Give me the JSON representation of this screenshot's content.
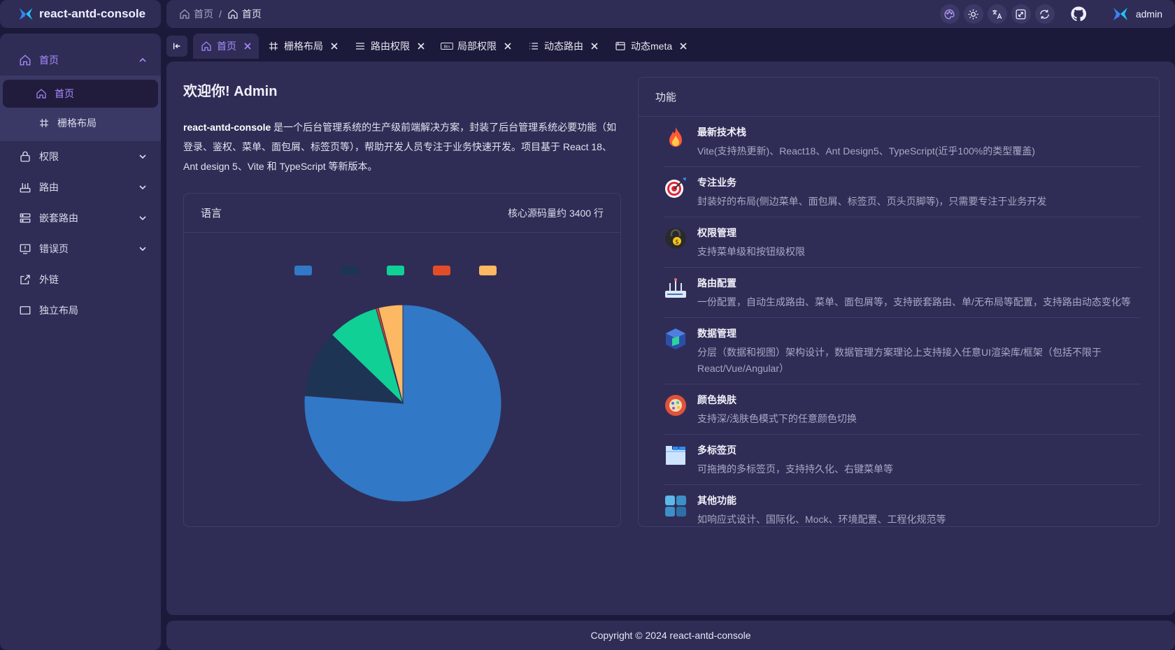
{
  "app": {
    "name": "react-antd-console"
  },
  "sidebar": {
    "items": [
      {
        "label": "首页",
        "icon": "home-icon",
        "open": true
      },
      {
        "label": "权限",
        "icon": "lock-icon"
      },
      {
        "label": "路由",
        "icon": "router-icon"
      },
      {
        "label": "嵌套路由",
        "icon": "server-icon"
      },
      {
        "label": "错误页",
        "icon": "error-monitor-icon"
      },
      {
        "label": "外链",
        "icon": "external-link-icon"
      },
      {
        "label": "独立布局",
        "icon": "layout-icon"
      }
    ],
    "home_children": [
      {
        "label": "首页",
        "icon": "home-icon",
        "active": true
      },
      {
        "label": "栅格布局",
        "icon": "grid-icon"
      }
    ]
  },
  "header": {
    "breadcrumb": [
      "首页",
      "首页"
    ],
    "breadcrumb_sep": "/",
    "tools": [
      "theme-palette-icon",
      "sun-icon",
      "translate-icon",
      "fullscreen-icon",
      "refresh-icon",
      "github-icon"
    ],
    "username": "admin"
  },
  "tabs": [
    {
      "label": "首页",
      "icon": "home-icon",
      "active": true
    },
    {
      "label": "栅格布局",
      "icon": "grid-icon"
    },
    {
      "label": "路由权限",
      "icon": "menu-icon"
    },
    {
      "label": "局部权限",
      "icon": "button-icon"
    },
    {
      "label": "动态路由",
      "icon": "list-icon"
    },
    {
      "label": "动态meta",
      "icon": "window-icon"
    }
  ],
  "welcome": {
    "title": "欢迎你! Admin",
    "intro_strong": "react-antd-console",
    "intro_text": " 是一个后台管理系统的生产级前端解决方案，封装了后台管理系统必要功能（如登录、鉴权、菜单、面包屑、标签页等），帮助开发人员专注于业务快速开发。项目基于 React 18、Ant design 5、Vite 和 TypeScript 等新版本。"
  },
  "lang_card": {
    "title": "语言",
    "extra": "核心源码量约 3400 行"
  },
  "chart_data": {
    "type": "pie",
    "legend_position": "top",
    "colors": [
      "#3178c6",
      "#1e3455",
      "#10d096",
      "#e34c26",
      "#fcb863"
    ],
    "values": [
      79.9,
      11.5,
      8.8,
      0.4,
      4.2
    ],
    "start_angle_deg": 0
  },
  "func_card": {
    "title": "功能",
    "features": [
      {
        "title": "最新技术栈",
        "desc": "Vite(支持热更新)、React18、Ant Design5、TypeScript(近乎100%的类型覆盖)",
        "icon": "fire-icon"
      },
      {
        "title": "专注业务",
        "desc": "封装好的布局(侧边菜单、面包屑、标签页、页头页脚等)，只需要专注于业务开发",
        "icon": "target-icon"
      },
      {
        "title": "权限管理",
        "desc": "支持菜单级和按钮级权限",
        "icon": "lock-badge-icon"
      },
      {
        "title": "路由配置",
        "desc": "一份配置，自动生成路由、菜单、面包屑等，支持嵌套路由、单/无布局等配置，支持路由动态变化等",
        "icon": "router-device-icon"
      },
      {
        "title": "数据管理",
        "desc": "分层（数据和视图）架构设计，数据管理方案理论上支持接入任意UI渲染库/框架（包括不限于React/Vue/Angular）",
        "icon": "data-cube-icon"
      },
      {
        "title": "颜色换肤",
        "desc": "支持深/浅肤色模式下的任意颜色切换",
        "icon": "palette-icon"
      },
      {
        "title": "多标签页",
        "desc": "可拖拽的多标签页，支持持久化、右键菜单等",
        "icon": "tabs-icon"
      },
      {
        "title": "其他功能",
        "desc": "如响应式设计、国际化、Mock、环境配置、工程化规范等",
        "icon": "apps-icon"
      }
    ]
  },
  "footer": {
    "text": "Copyright © 2024 react-antd-console"
  }
}
